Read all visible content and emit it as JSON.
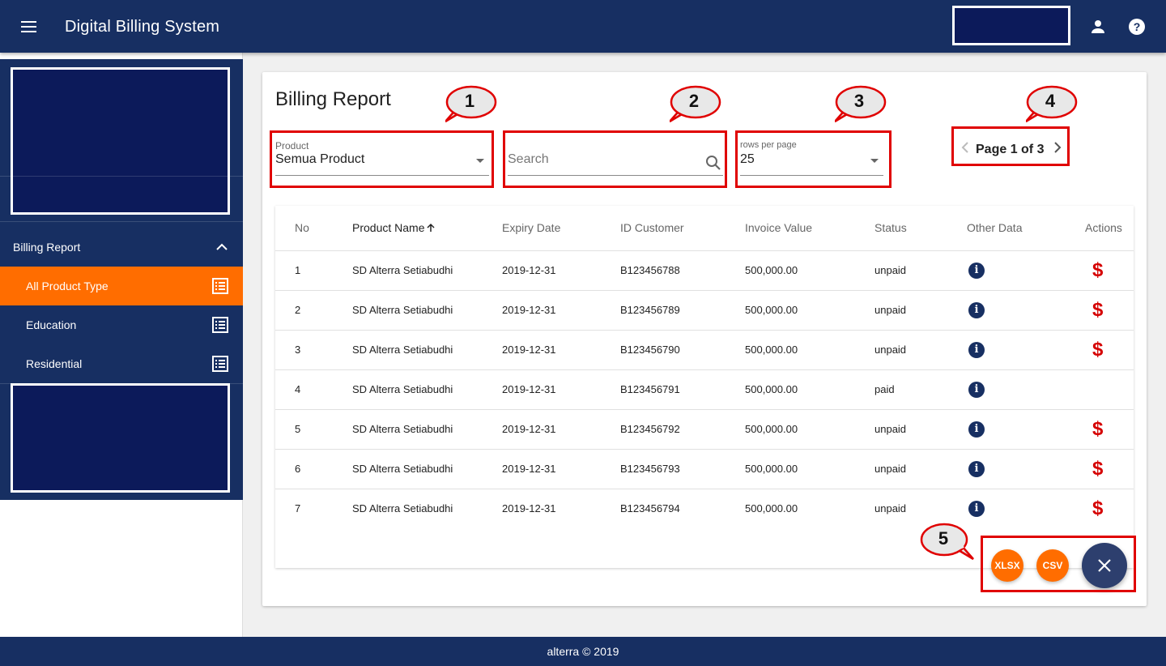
{
  "app": {
    "title": "Digital Billing System"
  },
  "sidebar": {
    "group_label": "Billing Report",
    "items": [
      {
        "label": "All Product Type",
        "active": true
      },
      {
        "label": "Education",
        "active": false
      },
      {
        "label": "Residential",
        "active": false
      }
    ]
  },
  "report": {
    "title": "Billing Report",
    "product_filter": {
      "label": "Product",
      "value": "Semua Product"
    },
    "search": {
      "placeholder": "Search"
    },
    "rows_per_page": {
      "label": "rows per page",
      "value": "25"
    },
    "pagination": {
      "text": "Page 1 of 3"
    }
  },
  "table": {
    "columns": [
      "No",
      "Product Name",
      "Expiry Date",
      "ID Customer",
      "Invoice Value",
      "Status",
      "Other Data",
      "Actions"
    ],
    "rows": [
      {
        "no": "1",
        "product": "SD Alterra Setiabudhi",
        "expiry": "2019-12-31",
        "id": "B123456788",
        "invoice": "500,000.00",
        "status": "unpaid"
      },
      {
        "no": "2",
        "product": "SD Alterra Setiabudhi",
        "expiry": "2019-12-31",
        "id": "B123456789",
        "invoice": "500,000.00",
        "status": "unpaid"
      },
      {
        "no": "3",
        "product": "SD Alterra Setiabudhi",
        "expiry": "2019-12-31",
        "id": "B123456790",
        "invoice": "500,000.00",
        "status": "unpaid"
      },
      {
        "no": "4",
        "product": "SD Alterra Setiabudhi",
        "expiry": "2019-12-31",
        "id": "B123456791",
        "invoice": "500,000.00",
        "status": "paid"
      },
      {
        "no": "5",
        "product": "SD Alterra Setiabudhi",
        "expiry": "2019-12-31",
        "id": "B123456792",
        "invoice": "500,000.00",
        "status": "unpaid"
      },
      {
        "no": "6",
        "product": "SD Alterra Setiabudhi",
        "expiry": "2019-12-31",
        "id": "B123456793",
        "invoice": "500,000.00",
        "status": "unpaid"
      },
      {
        "no": "7",
        "product": "SD Alterra Setiabudhi",
        "expiry": "2019-12-31",
        "id": "B123456794",
        "invoice": "500,000.00",
        "status": "unpaid"
      }
    ]
  },
  "export": {
    "xlsx_label": "XLSX",
    "csv_label": "CSV"
  },
  "annotations": [
    "1",
    "2",
    "3",
    "4",
    "5"
  ],
  "footer": {
    "text": "alterra  © 2019"
  },
  "colors": {
    "primary": "#172f62",
    "accent": "#ff6d00",
    "danger": "#d50000",
    "highlight": "#e00000"
  },
  "icons": {
    "menu": "menu-icon",
    "user": "person-icon",
    "help": "help-icon",
    "list": "list-alt-icon",
    "info": "info-icon",
    "pay": "dollar-icon",
    "close": "close-icon"
  }
}
